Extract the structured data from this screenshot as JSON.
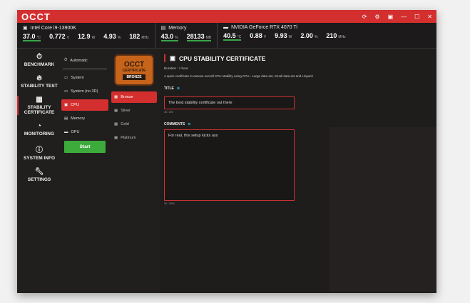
{
  "app": {
    "logo": "OCCT",
    "title_icons": [
      "refresh-icon",
      "settings-icon",
      "camera-icon",
      "minimize-icon",
      "maximize-icon",
      "close-icon"
    ]
  },
  "monitor": {
    "cpu": {
      "name": "Intel Core i9-13900K",
      "values": [
        {
          "v": "37.0",
          "u": "°C"
        },
        {
          "v": "0.772",
          "u": "V"
        },
        {
          "v": "12.9",
          "u": "W"
        },
        {
          "v": "4.93",
          "u": "%"
        },
        {
          "v": "182",
          "u": "MHz"
        }
      ]
    },
    "memory": {
      "name": "Memory",
      "values": [
        {
          "v": "43.0",
          "u": "%"
        },
        {
          "v": "28133",
          "u": "MB"
        }
      ]
    },
    "gpu": {
      "name": "NVIDIA GeForce RTX 4070 Ti",
      "values": [
        {
          "v": "40.5",
          "u": "°C"
        },
        {
          "v": "0.88",
          "u": "V"
        },
        {
          "v": "9.93",
          "u": "W"
        },
        {
          "v": "2.00",
          "u": "%"
        },
        {
          "v": "210",
          "u": "MHz"
        }
      ]
    }
  },
  "nav": [
    {
      "label": "BENCHMARK"
    },
    {
      "label": "STABILITY TEST"
    },
    {
      "label": "STABILITY CERTIFICATE"
    },
    {
      "label": "MONITORING"
    },
    {
      "label": "SYSTEM INFO"
    },
    {
      "label": "SETTINGS"
    }
  ],
  "modes": {
    "automatic": "Automatic",
    "items": [
      "System",
      "System (no 3D)",
      "CPU",
      "Memory",
      "GPU"
    ],
    "start": "Start"
  },
  "badge": {
    "title": "OCCT",
    "sub": "CERTIFICATE",
    "level": "BRONZE"
  },
  "levels": [
    "Bronze",
    "Silver",
    "Gold",
    "Platinum"
  ],
  "main": {
    "title": "CPU STABILITY CERTIFICATE",
    "duration": "Duration : 1 hour.",
    "description": "A quick certificate to assess overall CPU stability using CPU - Large data set, Small data set and Linpack",
    "title_label": "TITLE",
    "title_value": "The best stability certificate out there",
    "title_count": "40 / 200",
    "comments_label": "COMMENTS",
    "comments_value": "For real, this setup kicks ass",
    "comments_count": "30 / 2000"
  }
}
